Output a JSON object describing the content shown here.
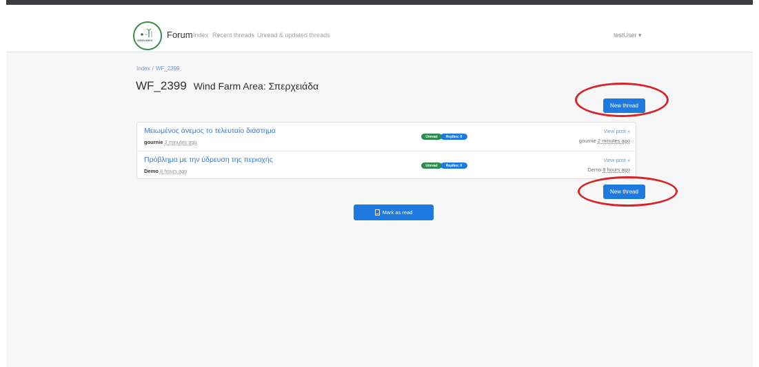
{
  "navbar": {
    "brand": "Forum",
    "logo_text": "WINDAWID",
    "links": [
      {
        "label": "Index"
      },
      {
        "label": "Recent threads"
      },
      {
        "label": "Unread & updated threads"
      }
    ],
    "user": "testUser ▾"
  },
  "breadcrumb": {
    "items": [
      "Index",
      "WF_2399"
    ],
    "separator": "/"
  },
  "page": {
    "code": "WF_2399",
    "subtitle": "Wind Farm Area: Σπερχειάδα"
  },
  "actions": {
    "new_thread_label": "New thread",
    "mark_read_label": "Mark as read",
    "mark_read_icon": "book-icon"
  },
  "threads": [
    {
      "title": "Μειωμένος άνεμος το τελευταίο διάστημα",
      "author": "gournie",
      "ago": "2 minutes ago",
      "badge_unread": "Unread",
      "badge_replies": "Replies: 0",
      "view_post": "View post »",
      "last_author": "gournie",
      "last_ago": "2 minutes ago"
    },
    {
      "title": "Πρόβλημα με την ύδρευση της περιοχής",
      "author": "Demo",
      "ago": "8 hours ago",
      "badge_unread": "Unread",
      "badge_replies": "Replies: 0",
      "view_post": "View post »",
      "last_author": "Demo",
      "last_ago": "8 hours ago"
    }
  ],
  "colors": {
    "accent": "#1f7ae0",
    "unread_badge": "#2f8a4e",
    "annotation": "#d6252a"
  }
}
